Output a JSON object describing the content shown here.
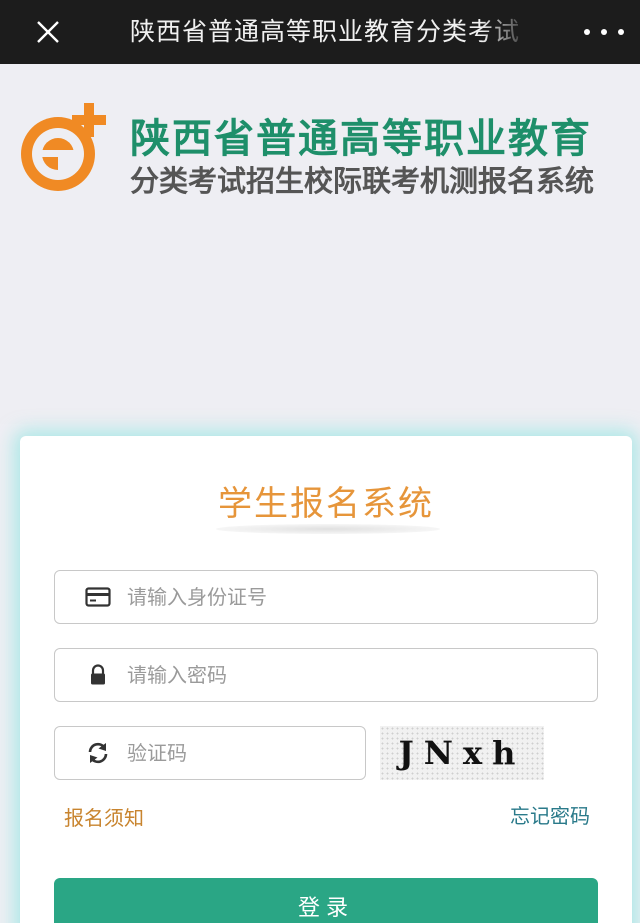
{
  "topbar": {
    "title": "陕西省普通高等职业教育分类考试",
    "close_icon": "close-icon",
    "more_icon": "more-icon"
  },
  "header": {
    "logo_line1": "陕西省普通高等职业教育",
    "logo_line2": "分类考试招生校际联考机测报名系统",
    "logo_colors": {
      "orange": "#f08a24",
      "green": "#1e8f6a"
    }
  },
  "login": {
    "title": "学生报名系统",
    "id_placeholder": "请输入身份证号",
    "password_placeholder": "请输入密码",
    "captcha_placeholder": "验证码",
    "captcha_text": "JNxh",
    "notice_link": "报名须知",
    "forgot_link": "忘记密码",
    "submit_label": "登录"
  },
  "colors": {
    "accent": "#2aa685",
    "title_orange": "#e6953a",
    "link_orange": "#c8842e",
    "link_teal": "#2a7a8a"
  }
}
